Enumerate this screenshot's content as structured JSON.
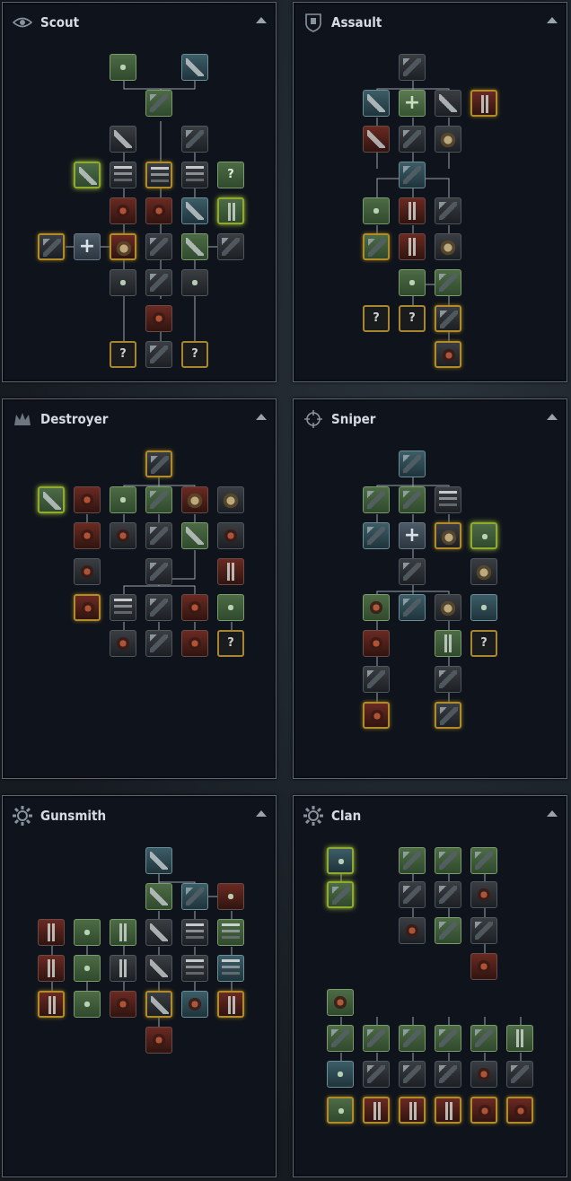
{
  "panels": [
    {
      "title": "Scout",
      "icon": "eye-icon"
    },
    {
      "title": "Assault",
      "icon": "shield-fist-icon"
    },
    {
      "title": "Destroyer",
      "icon": "crown-icon"
    },
    {
      "title": "Sniper",
      "icon": "crosshair-icon"
    },
    {
      "title": "Gunsmith",
      "icon": "gear-icon"
    },
    {
      "title": "Clan",
      "icon": "gear-icon"
    }
  ],
  "labels": {
    "mystery": "?",
    "plus": "+"
  },
  "colors": {
    "panel_bg": "#0f141c",
    "border": "#5d6570",
    "title": "#d5dbe2",
    "line": "#9ea5ad",
    "gold": "#b18b2a",
    "glow": "#8faa2c"
  }
}
